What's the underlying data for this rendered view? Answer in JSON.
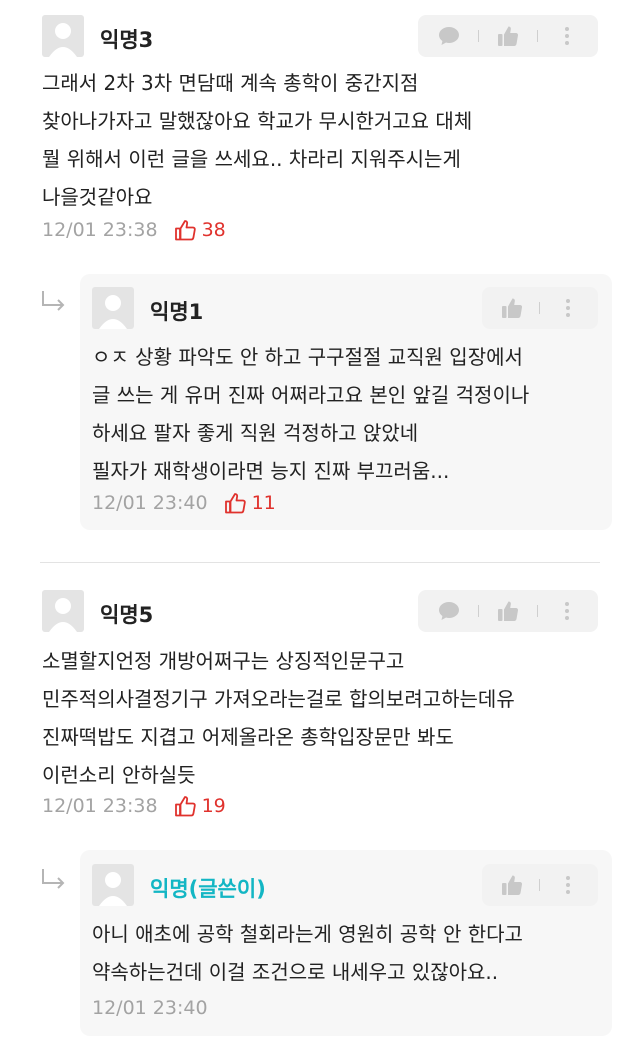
{
  "comments": [
    {
      "author": "익명3",
      "text": "그래서 2차 3차 면담때 계속 총학이 중간지점\n찾아나가자고 말했잖아요 학교가 무시한거고요 대체\n뭘 위해서 이런 글을 쓰세요.. 차라리 지워주시는게\n나을것같아요",
      "time": "12/01 23:38",
      "likes": "38"
    },
    {
      "author": "익명1",
      "text": "ㅇㅈ 상황 파악도 안 하고 구구절절 교직원 입장에서\n글 쓰는 게 유머 진짜 어쩌라고요 본인 앞길 걱정이나\n하세요 팔자 좋게 직원 걱정하고 앉았네\n필자가 재학생이라면 능지 진짜 부끄러움...",
      "time": "12/01 23:40",
      "likes": "11"
    },
    {
      "author": "익명5",
      "text": "소멸할지언정 개방어쩌구는 상징적인문구고\n민주적의사결정기구 가져오라는걸로 합의보려고하는데유\n진짜떡밥도 지겹고 어제올라온 총학입장문만 봐도\n이런소리 안하실듯",
      "time": "12/01 23:38",
      "likes": "19"
    },
    {
      "author": "익명(글쓴이)",
      "text": "아니 애초에 공학 철회라는게 영원히 공학 안 한다고\n약속하는건데 이걸 조건으로 내세우고 있잖아요..",
      "time": "12/01 23:40"
    }
  ],
  "icons": {
    "comment": "speech-bubble-icon",
    "like": "thumbs-up-icon",
    "more": "more-vertical-icon",
    "reply": "reply-arrow-icon",
    "heart": "like-count-icon"
  },
  "colors": {
    "accent_like": "#e0322d",
    "op_author": "#13b6c4",
    "meta_gray": "#a3a3a3",
    "action_bg": "#f2f2f2",
    "reply_bg": "#f7f7f7"
  }
}
